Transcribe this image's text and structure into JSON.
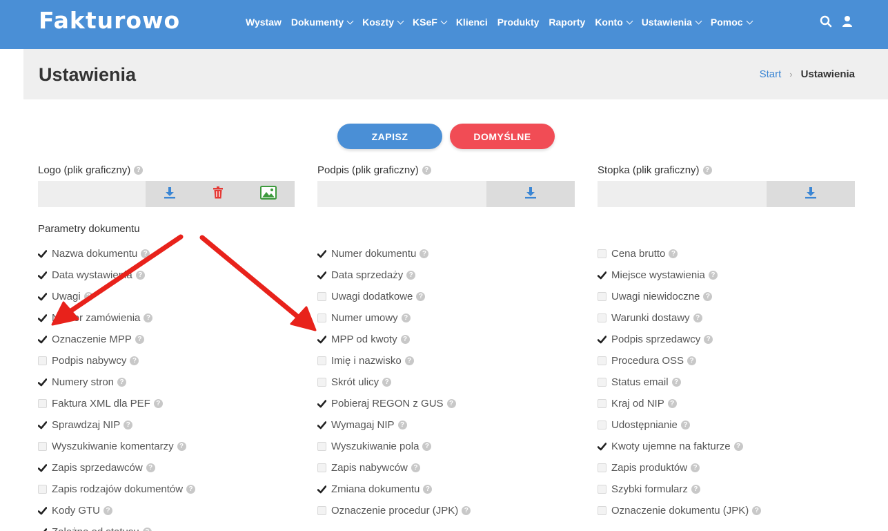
{
  "brand": "Fakturowo",
  "nav": [
    {
      "label": "Wystaw",
      "dropdown": false
    },
    {
      "label": "Dokumenty",
      "dropdown": true
    },
    {
      "label": "Koszty",
      "dropdown": true
    },
    {
      "label": "KSeF",
      "dropdown": true
    },
    {
      "label": "Klienci",
      "dropdown": false
    },
    {
      "label": "Produkty",
      "dropdown": false
    },
    {
      "label": "Raporty",
      "dropdown": false
    },
    {
      "label": "Konto",
      "dropdown": true
    },
    {
      "label": "Ustawienia",
      "dropdown": true
    },
    {
      "label": "Pomoc",
      "dropdown": true
    }
  ],
  "header": {
    "title": "Ustawienia",
    "breadcrumb_home": "Start",
    "breadcrumb_current": "Ustawienia"
  },
  "buttons": {
    "save": "ZAPISZ",
    "default": "DOMYŚLNE"
  },
  "uploads": {
    "logo": "Logo (plik graficzny)",
    "signature": "Podpis (plik graficzny)",
    "footer": "Stopka (plik graficzny)"
  },
  "section_title": "Parametry dokumentu",
  "columns": [
    [
      {
        "label": "Nazwa dokumentu",
        "checked": true
      },
      {
        "label": "Data wystawienia",
        "checked": true
      },
      {
        "label": "Uwagi",
        "checked": true
      },
      {
        "label": "Numer zamówienia",
        "checked": true
      },
      {
        "label": "Oznaczenie MPP",
        "checked": true
      },
      {
        "label": "Podpis nabywcy",
        "checked": false
      },
      {
        "label": "Numery stron",
        "checked": true
      },
      {
        "label": "Faktura XML dla PEF",
        "checked": false
      },
      {
        "label": "Sprawdzaj NIP",
        "checked": true
      },
      {
        "label": "Wyszukiwanie komentarzy",
        "checked": false
      },
      {
        "label": "Zapis sprzedawców",
        "checked": true
      },
      {
        "label": "Zapis rodzajów dokumentów",
        "checked": false
      },
      {
        "label": "Kody GTU",
        "checked": true
      },
      {
        "label": "Zależne od statusu",
        "checked": true
      }
    ],
    [
      {
        "label": "Numer dokumentu",
        "checked": true
      },
      {
        "label": "Data sprzedaży",
        "checked": true
      },
      {
        "label": "Uwagi dodatkowe",
        "checked": false
      },
      {
        "label": "Numer umowy",
        "checked": false
      },
      {
        "label": "MPP od kwoty",
        "checked": true
      },
      {
        "label": "Imię i nazwisko",
        "checked": false
      },
      {
        "label": "Skrót ulicy",
        "checked": false
      },
      {
        "label": "Pobieraj REGON z GUS",
        "checked": true
      },
      {
        "label": "Wymagaj NIP",
        "checked": true
      },
      {
        "label": "Wyszukiwanie pola",
        "checked": false
      },
      {
        "label": "Zapis nabywców",
        "checked": false
      },
      {
        "label": "Zmiana dokumentu",
        "checked": true
      },
      {
        "label": "Oznaczenie procedur (JPK)",
        "checked": false
      }
    ],
    [
      {
        "label": "Cena brutto",
        "checked": false
      },
      {
        "label": "Miejsce wystawienia",
        "checked": true
      },
      {
        "label": "Uwagi niewidoczne",
        "checked": false
      },
      {
        "label": "Warunki dostawy",
        "checked": false
      },
      {
        "label": "Podpis sprzedawcy",
        "checked": true
      },
      {
        "label": "Procedura OSS",
        "checked": false
      },
      {
        "label": "Status email",
        "checked": false
      },
      {
        "label": "Kraj od NIP",
        "checked": false
      },
      {
        "label": "Udostępnianie",
        "checked": false
      },
      {
        "label": "Kwoty ujemne na fakturze",
        "checked": true
      },
      {
        "label": "Zapis produktów",
        "checked": false
      },
      {
        "label": "Szybki formularz",
        "checked": false
      },
      {
        "label": "Oznaczenie dokumentu (JPK)",
        "checked": false
      }
    ]
  ],
  "colors": {
    "brand": "#4a8fd6",
    "danger": "#f14c55",
    "arrow": "#e8221b"
  }
}
